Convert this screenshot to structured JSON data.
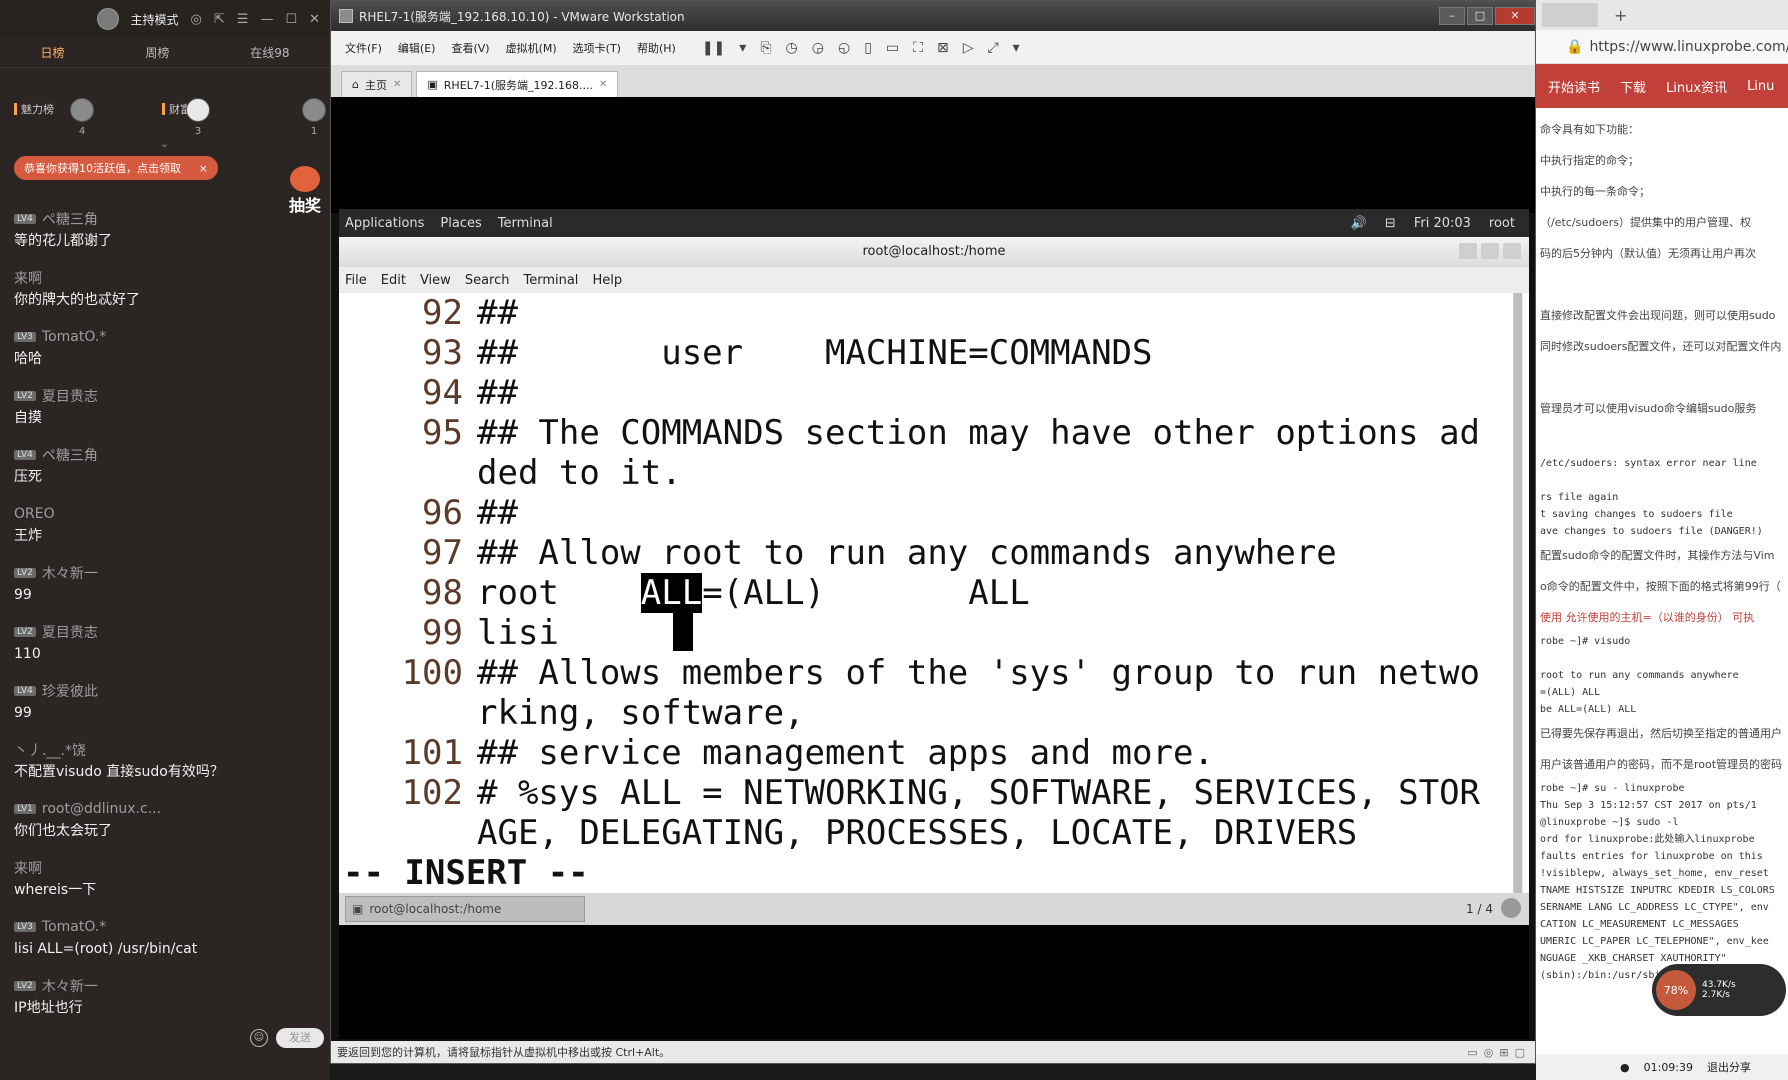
{
  "chat": {
    "host_mode": "主持模式",
    "rank_tabs": [
      "日榜",
      "周榜",
      "在线98"
    ],
    "boards": [
      "魅力榜",
      "财富榜"
    ],
    "top_users": [
      {
        "rank": "4"
      },
      {
        "rank": "3"
      },
      {
        "rank": "1"
      }
    ],
    "notice": "恭喜你获得10活跃值，点击领取",
    "lottery": "抽奖",
    "messages": [
      {
        "lv": "LV4",
        "name": "ペ糖三角",
        "text": "等的花儿都谢了"
      },
      {
        "lv": "",
        "name": "来啊",
        "text": "你的牌大的也忒好了"
      },
      {
        "lv": "LV3",
        "name": "TomatO.*",
        "text": "哈哈"
      },
      {
        "lv": "LV2",
        "name": "夏目贵志",
        "text": "自摸"
      },
      {
        "lv": "LV4",
        "name": "ペ糖三角",
        "text": "压死"
      },
      {
        "lv": "",
        "name": "OREO",
        "text": "王炸"
      },
      {
        "lv": "LV2",
        "name": "木々新一",
        "text": "99"
      },
      {
        "lv": "LV2",
        "name": "夏目贵志",
        "text": "110"
      },
      {
        "lv": "LV4",
        "name": "珍爱彼此",
        "text": "99"
      },
      {
        "lv": "",
        "name": "丶丿.__.*饶",
        "text": "不配置visudo    直接sudo有效吗？"
      },
      {
        "lv": "LV1",
        "name": "root@ddlinux.c...",
        "text": "你们也太会玩了"
      },
      {
        "lv": "",
        "name": "来啊",
        "text": "whereis一下"
      },
      {
        "lv": "LV3",
        "name": "TomatO.*",
        "text": "lisi ALL=(root)   /usr/bin/cat"
      },
      {
        "lv": "LV2",
        "name": "木々新一",
        "text": "IP地址也行"
      }
    ],
    "send_label": "发送"
  },
  "vmware": {
    "title": "RHEL7-1(服务端_192.168.10.10) - VMware Workstation",
    "menu": [
      "文件(F)",
      "编辑(E)",
      "查看(V)",
      "虚拟机(M)",
      "选项卡(T)",
      "帮助(H)"
    ],
    "tabs": [
      {
        "label": "主页",
        "active": false
      },
      {
        "label": "RHEL7-1(服务端_192.168....",
        "active": true
      }
    ],
    "status": "要返回到您的计算机，请将鼠标指针从虚拟机中移出或按 Ctrl+Alt。"
  },
  "gnome": {
    "applications": "Applications",
    "places": "Places",
    "terminal": "Terminal",
    "time": "Fri 20:03",
    "user": "root"
  },
  "terminal": {
    "title": "root@localhost:/home",
    "menu": [
      "File",
      "Edit",
      "View",
      "Search",
      "Terminal",
      "Help"
    ],
    "lines": [
      {
        "n": "92",
        "t": "##"
      },
      {
        "n": "93",
        "t": "##       user    MACHINE=COMMANDS"
      },
      {
        "n": "94",
        "t": "##"
      },
      {
        "n": "95",
        "t": "## The COMMANDS section may have other options ad"
      },
      {
        "n": "",
        "t": "ded to it."
      },
      {
        "n": "96",
        "t": "##"
      },
      {
        "n": "97",
        "t": "## Allow root to run any commands anywhere"
      },
      {
        "n": "98",
        "t": "root    ALL=(ALL)       ALL"
      },
      {
        "n": "99",
        "t": "lisi"
      },
      {
        "n": "100",
        "t": "## Allows members of the 'sys' group to run netwo"
      },
      {
        "n": "",
        "t": "rking, software,"
      },
      {
        "n": "101",
        "t": "## service management apps and more."
      },
      {
        "n": "102",
        "t": "# %sys ALL = NETWORKING, SOFTWARE, SERVICES, STOR"
      },
      {
        "n": "",
        "t": "AGE, DELEGATING, PROCESSES, LOCATE, DRIVERS"
      }
    ],
    "mode": "-- INSERT --",
    "task_label": "root@localhost:/home",
    "pager": "1 / 4"
  },
  "browser": {
    "url": "https://www.linuxprobe.com/",
    "nav": [
      "开始读书",
      "下载",
      "Linux资讯",
      "Linu"
    ],
    "paragraphs": [
      "命令具有如下功能：",
      "中执行指定的命令；",
      "中执行的每一条命令；",
      "（/etc/sudoers）提供集中的用户管理、权",
      "码的后5分钟内（默认值）无须再让用户再次",
      "",
      "直接修改配置文件会出现问题，则可以使用sudo",
      "同时修改sudoers配置文件，还可以对配置文件内",
      "",
      "管理员才可以使用visudo命令编辑sudo服务",
      ""
    ],
    "code1": [
      "/etc/sudoers: syntax error near line",
      "",
      "rs file again",
      "t saving changes to sudoers file",
      "ave changes to sudoers file (DANGER!)"
    ],
    "paragraphs2": [
      "配置sudo命令的配置文件时，其操作方法与Vim",
      "o命令的配置文件中，按照下面的格式将第99行（"
    ],
    "highlight": "使用 允许使用的主机=（以谁的身份） 可执",
    "code2": [
      "robe ~]# visudo",
      "",
      "root to run any commands anywhere",
      "=(ALL) ALL",
      "be ALL=(ALL) ALL"
    ],
    "paragraphs3": [
      "已得要先保存再退出，然后切换至指定的普通用户",
      "用户该普通用户的密码，而不是root管理员的密码"
    ],
    "code3": [
      "robe ~]# su - linuxprobe",
      "Thu Sep 3 15:12:57 CST 2017 on pts/1",
      "@linuxprobe ~]$ sudo -l",
      "ord for linuxprobe:此处输入linuxprobe",
      "faults entries for linuxprobe on this",
      " !visiblepw, always_set_home, env_reset",
      "TNAME HISTSIZE INPUTRC KDEDIR LS_COLORS",
      "SERNAME LANG LC_ADDRESS LC_CTYPE\", env",
      "CATION LC_MEASUREMENT LC_MESSAGES",
      "UMERIC LC_PAPER LC_TELEPHONE\", env_kee",
      "NGUAGE _XKB_CHARSET XAUTHORITY\"",
      "(sbin):/bin:/usr/sbin:/usr/bin"
    ],
    "net_pct": "78%",
    "net_up": "43.7K/s",
    "net_down": "2.7K/s",
    "timer": "01:09:39",
    "exit_share": "退出分享"
  }
}
